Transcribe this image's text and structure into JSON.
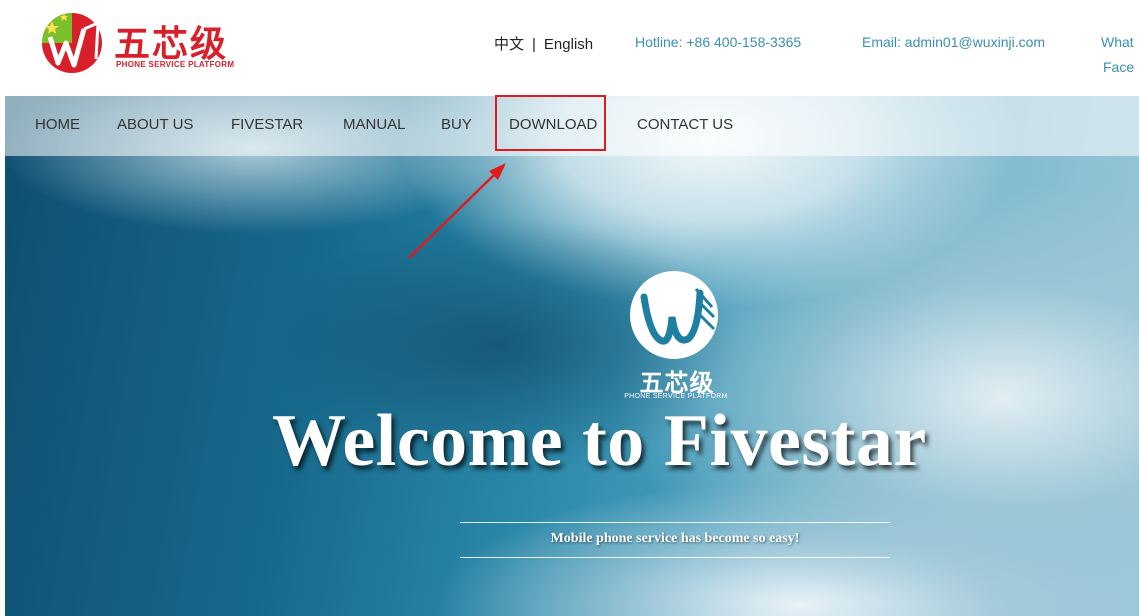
{
  "header": {
    "logo_cn": "五芯级",
    "logo_en": "PHONE SERVICE PLATFORM",
    "lang_cn": "中文",
    "lang_sep": "|",
    "lang_en": "English",
    "hotline": "Hotline: +86 400-158-3365",
    "email": "Email: admin01@wuxinji.com",
    "whats": "What",
    "face": "Face"
  },
  "nav": {
    "items": [
      "HOME",
      "ABOUT US",
      "FIVESTAR",
      "MANUAL",
      "BUY",
      "DOWNLOAD",
      "CONTACT US"
    ]
  },
  "hero": {
    "logo_cn": "五芯级",
    "logo_en": "PHONE SERVICE PLATFORM",
    "welcome": "Welcome to Fivestar",
    "tagline": "Mobile phone service has become so easy!"
  },
  "colors": {
    "brand_red": "#d8202b",
    "link_blue": "#3a8fb7",
    "highlight": "#e01b1b"
  }
}
